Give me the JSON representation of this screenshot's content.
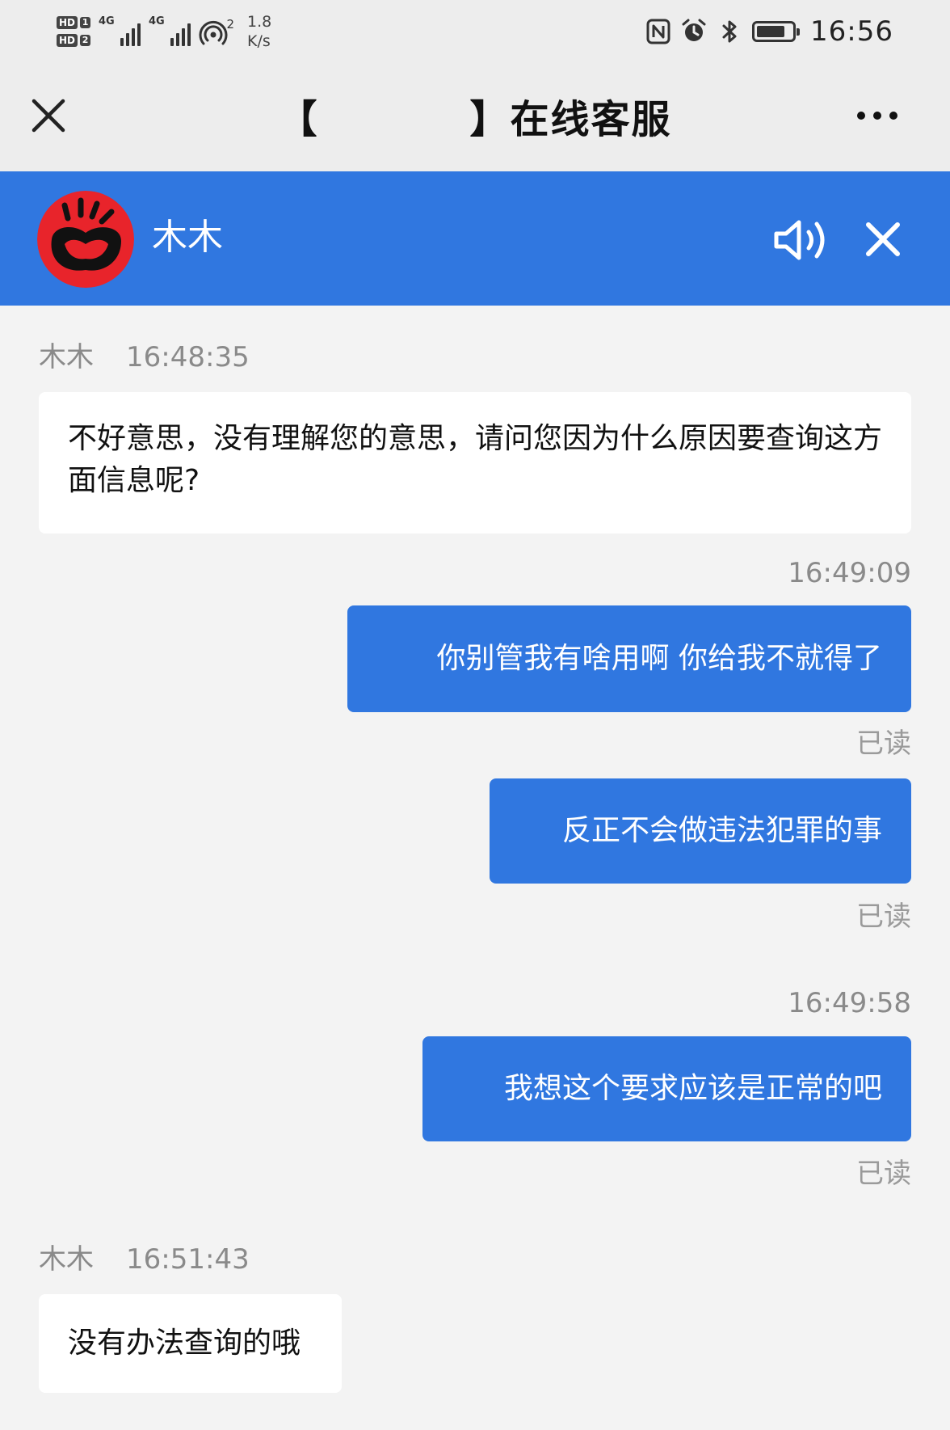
{
  "status_bar": {
    "hd1": "HD",
    "hd1_num": "1",
    "hd2": "HD",
    "hd2_num": "2",
    "signal1_label": "4G",
    "signal2_label": "4G",
    "hotspot_sup": "2",
    "speed_value": "1.8",
    "speed_unit": "K/s",
    "time": "16:56",
    "battery_level": 0.8,
    "icons": [
      "nfc-icon",
      "alarm-icon",
      "bluetooth-icon",
      "battery-icon"
    ]
  },
  "title_bar": {
    "title": "【          】在线客服",
    "close_icon": "close-icon",
    "more_icon": "more-icon"
  },
  "agent": {
    "name": "木木",
    "avatar": "avatar",
    "sound_icon": "speaker-icon",
    "close_icon": "close-icon",
    "accent_color": "#3077e0"
  },
  "messages": [
    {
      "from": "agent",
      "sender": "木木",
      "time": "16:48:35",
      "text": "不好意思，没有理解您的意思，请问您因为什么原因要查询这方面信息呢?"
    },
    {
      "from": "user",
      "time": "16:49:09",
      "text": "你别管我有啥用啊 你给我不就得了",
      "status": "已读"
    },
    {
      "from": "user",
      "text": "反正不会做违法犯罪的事",
      "status": "已读"
    },
    {
      "from": "user",
      "time": "16:49:58",
      "text": "我想这个要求应该是正常的吧",
      "status": "已读"
    },
    {
      "from": "agent",
      "sender": "木木",
      "time": "16:51:43",
      "text": "没有办法查询的哦"
    }
  ]
}
